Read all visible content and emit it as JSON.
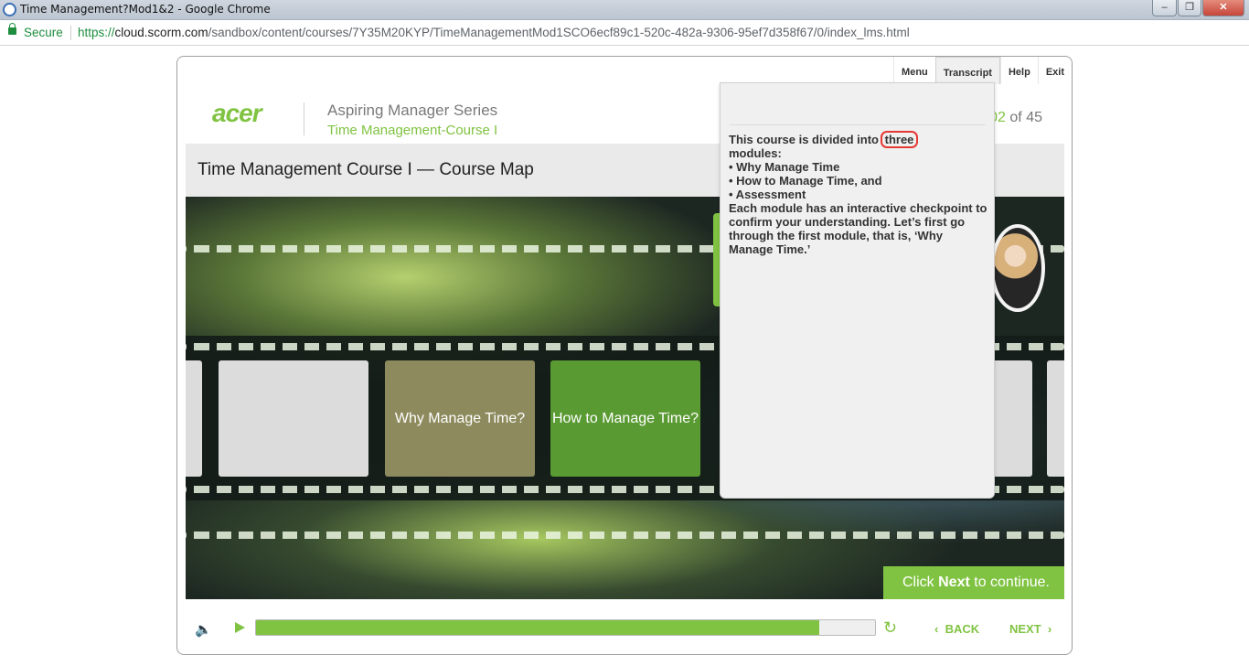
{
  "browser": {
    "title": "Time Management?Mod1&2 - Google Chrome",
    "secure_label": "Secure",
    "url_scheme": "https://",
    "url_host": "cloud.scorm.com",
    "url_path": "/sandbox/content/courses/7Y35M20KYP/TimeManagementMod1SCO6ecf89c1-520c-482a-9306-95ef7d358f67/0/index_lms.html",
    "window_controls": {
      "minimize": "‒",
      "maximize": "❐",
      "close": "✕"
    }
  },
  "nav": {
    "menu": "Menu",
    "transcript": "Transcript",
    "help": "Help",
    "exit": "Exit"
  },
  "header": {
    "logo": "acer",
    "series": "Aspiring Manager Series",
    "course": "Time Management-Course I",
    "page_current": "02",
    "page_sep": "of",
    "page_total": "45"
  },
  "slide": {
    "title": "Time Management Course I — Course Map",
    "tiles": [
      {
        "label": "Why Manage Time?"
      },
      {
        "label": "How to Manage Time?"
      }
    ],
    "next_prompt_pre": "Click ",
    "next_prompt_bold": "Next",
    "next_prompt_post": " to continue."
  },
  "transcript": {
    "intro_pre": "This course is divided into",
    "intro_highlight": "three",
    "intro_post": "modules:",
    "items": [
      "• Why Manage Time",
      "• How to Manage Time, and",
      "• Assessment"
    ],
    "outro": "Each module has an interactive checkpoint to confirm your understanding. Let’s first go through the first module, that is, ‘Why Manage Time.’"
  },
  "controls": {
    "progress_fraction": 0.91,
    "back_label": "BACK",
    "next_label": "NEXT",
    "icons": {
      "speaker": "speaker-icon",
      "play": "play-icon",
      "replay": "replay-icon"
    }
  },
  "colors": {
    "accent": "#80c342",
    "highlight": "#e53935"
  }
}
